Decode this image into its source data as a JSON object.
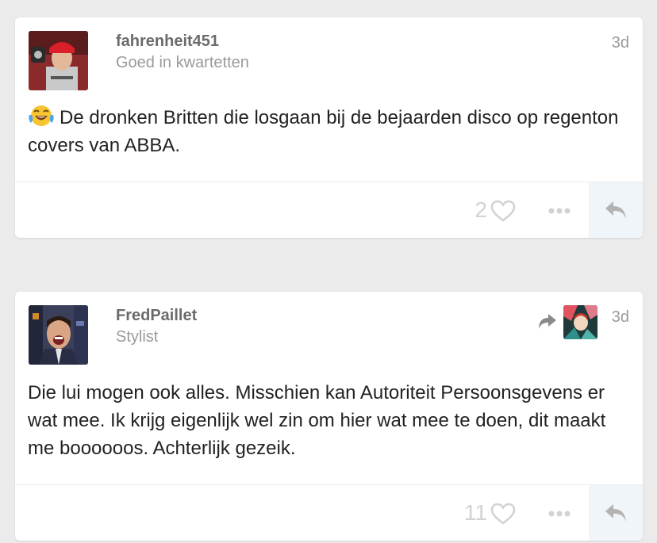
{
  "posts": [
    {
      "username": "fahrenheit451",
      "subtitle": "Goed in kwartetten",
      "time": "3d",
      "emoji": "laughing-crying-emoji",
      "text": "De dronken Britten die losgaan bij de bejaarden disco op regenton covers van ABBA.",
      "likes": "2"
    },
    {
      "username": "FredPaillet",
      "subtitle": "Stylist",
      "time": "3d",
      "text": "Die lui mogen ook alles. Misschien kan Autoriteit Persoonsgevens er wat mee. Ik krijg eigenlijk wel zin om hier wat mee te doen, dit maakt me boooooos. Achterlijk gezeik.",
      "likes": "11"
    }
  ],
  "colors": {
    "background": "#ebebeb",
    "card": "#ffffff",
    "username": "#6b6b6b",
    "muted": "#9a9a9a",
    "icon": "#d2d2d2",
    "reply_bg": "#f0f5f9"
  }
}
